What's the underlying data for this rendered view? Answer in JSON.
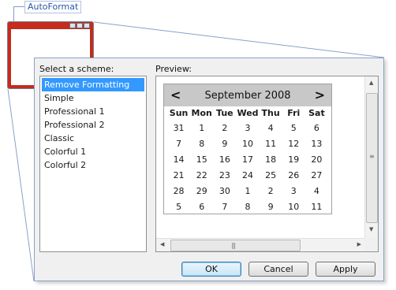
{
  "callout": {
    "label": "AutoFormat"
  },
  "dialog": {
    "scheme_label": "Select a scheme:",
    "preview_label": "Preview:",
    "schemes": [
      "Remove Formatting",
      "Simple",
      "Professional 1",
      "Professional 2",
      "Classic",
      "Colorful 1",
      "Colorful 2"
    ],
    "selected_scheme": "Remove Formatting",
    "buttons": {
      "ok": "OK",
      "cancel": "Cancel",
      "apply": "Apply"
    }
  },
  "calendar": {
    "title": "September 2008",
    "prev": "<",
    "next": ">",
    "days_of_week": [
      "Sun",
      "Mon",
      "Tue",
      "Wed",
      "Thu",
      "Fri",
      "Sat"
    ],
    "weeks": [
      [
        "31",
        "1",
        "2",
        "3",
        "4",
        "5",
        "6"
      ],
      [
        "7",
        "8",
        "9",
        "10",
        "11",
        "12",
        "13"
      ],
      [
        "14",
        "15",
        "16",
        "17",
        "18",
        "19",
        "20"
      ],
      [
        "21",
        "22",
        "23",
        "24",
        "25",
        "26",
        "27"
      ],
      [
        "28",
        "29",
        "30",
        "1",
        "2",
        "3",
        "4"
      ],
      [
        "5",
        "6",
        "7",
        "8",
        "9",
        "10",
        "11"
      ]
    ]
  },
  "colors": {
    "selection": "#3399ff",
    "calendar_header": "#c8c8c8",
    "thumbnail_frame": "#c62b1c",
    "callout_text": "#2a56a8"
  }
}
